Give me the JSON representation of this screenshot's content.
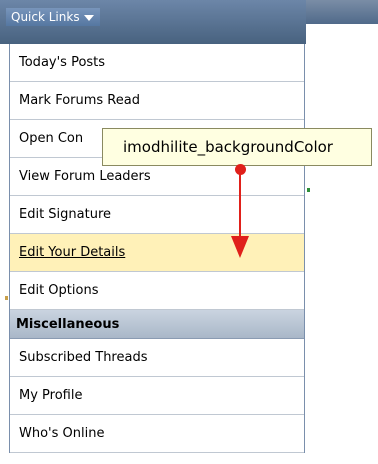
{
  "quick_links": {
    "label": "Quick Links",
    "icon": "caret-down-icon"
  },
  "menu": {
    "items_top": [
      {
        "label": "Today's Posts"
      },
      {
        "label": "Mark Forums Read"
      },
      {
        "label": "Open Con"
      },
      {
        "label": "View Forum Leaders"
      },
      {
        "label": "Edit Signature"
      },
      {
        "label": "Edit Your Details",
        "highlighted": true
      },
      {
        "label": "Edit Options"
      }
    ],
    "section_heading": "Miscellaneous",
    "items_bottom": [
      {
        "label": "Subscribed Threads"
      },
      {
        "label": "My Profile"
      },
      {
        "label": "Who's Online"
      }
    ]
  },
  "tooltip": {
    "text": "imodhilite_backgroundColor"
  },
  "colors": {
    "highlight": "#fff1b8",
    "arrow": "#e0201a",
    "tooltip_bg": "#ffffe1",
    "header": "#5577a1"
  }
}
